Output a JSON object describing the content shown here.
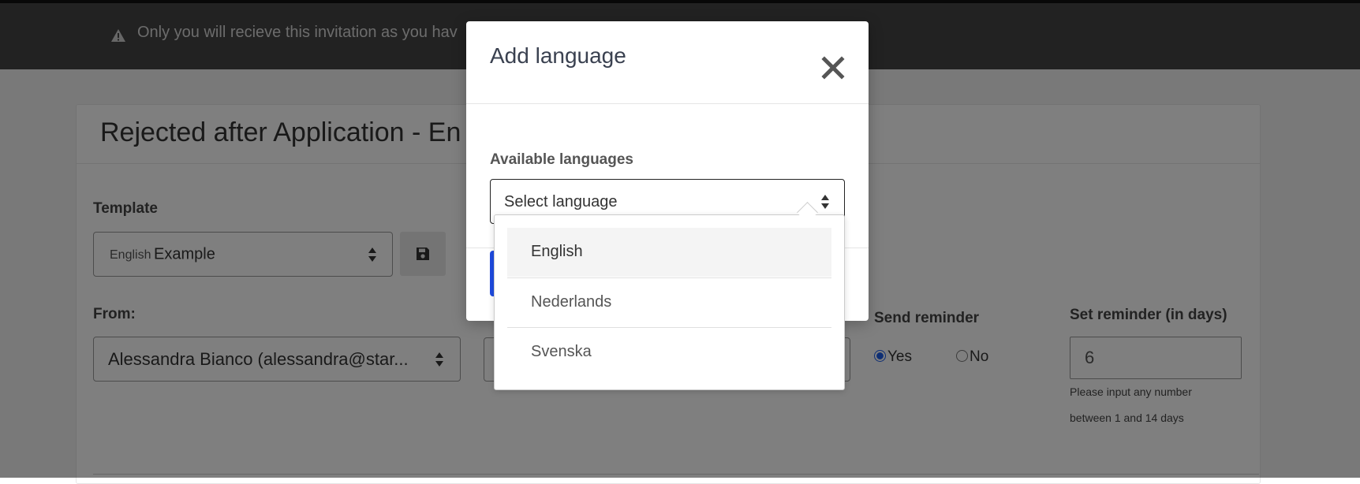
{
  "banner": {
    "text": "Only you will recieve this invitation as you hav"
  },
  "page": {
    "title": "Rejected after Application - En",
    "template_label": "Template",
    "template_lang": "English",
    "template_value": "Example",
    "from_label": "From:",
    "from_value": "Alessandra Bianco (alessandra@star...",
    "send_reminder_label": "Send reminder",
    "reminder_yes": "Yes",
    "reminder_no": "No",
    "set_reminder_label": "Set reminder (in days)",
    "reminder_days": "6",
    "hint_line1": "Please input any number",
    "hint_line2": "between 1 and 14 days"
  },
  "modal": {
    "title": "Add language",
    "available_label": "Available languages",
    "select_placeholder": "Select language"
  },
  "dropdown": {
    "options": [
      "English",
      "Nederlands",
      "Svenska"
    ]
  },
  "colors": {
    "primary": "#1f4be0",
    "banner": "#454545"
  }
}
